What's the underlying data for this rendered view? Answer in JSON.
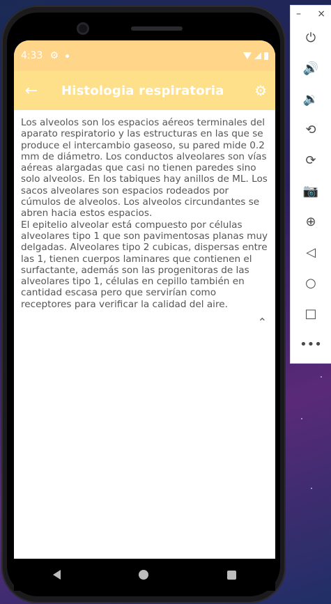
{
  "status": {
    "time": "4:33"
  },
  "app": {
    "title": "Histologia respiratoria"
  },
  "content": {
    "text": " Los alveolos son los espacios aéreos terminales del aparato respiratorio y las estructuras en las que se produce el intercambio gaseoso, su pared mide 0.2 mm de diámetro.  Los conductos alveolares son vías aéreas alargadas que casi no tienen paredes sino solo alveolos. En los tabiques hay anillos de ML. Los sacos alveolares son espacios rodeados por cúmulos de alveolos. Los alveolos circundantes se abren hacia estos espacios.\nEl epitelio alveolar está compuesto por células alveolares tipo 1 que son pavimentosas  planas muy delgadas. Alveolares tipo 2 cubicas, dispersas entre las 1, tienen cuerpos laminares que contienen el surfactante, además son las progenitoras de las alveolares tipo 1,  células en cepillo también en cantidad escasa pero que servirían como receptores para verificar la calidad del aire."
  },
  "colors": {
    "statusbar": "#ffd58a",
    "appbar": "#ffe08a"
  },
  "icons": {
    "back": "arrow-left-icon",
    "settings": "gear-icon",
    "collapse": "chevron-up-icon"
  },
  "emulator_panel": {
    "minimize": "–",
    "close": "×",
    "tools": [
      "power",
      "volume-up",
      "volume-down",
      "rotate-left",
      "rotate-right",
      "camera",
      "zoom",
      "back",
      "home",
      "overview",
      "more"
    ]
  }
}
